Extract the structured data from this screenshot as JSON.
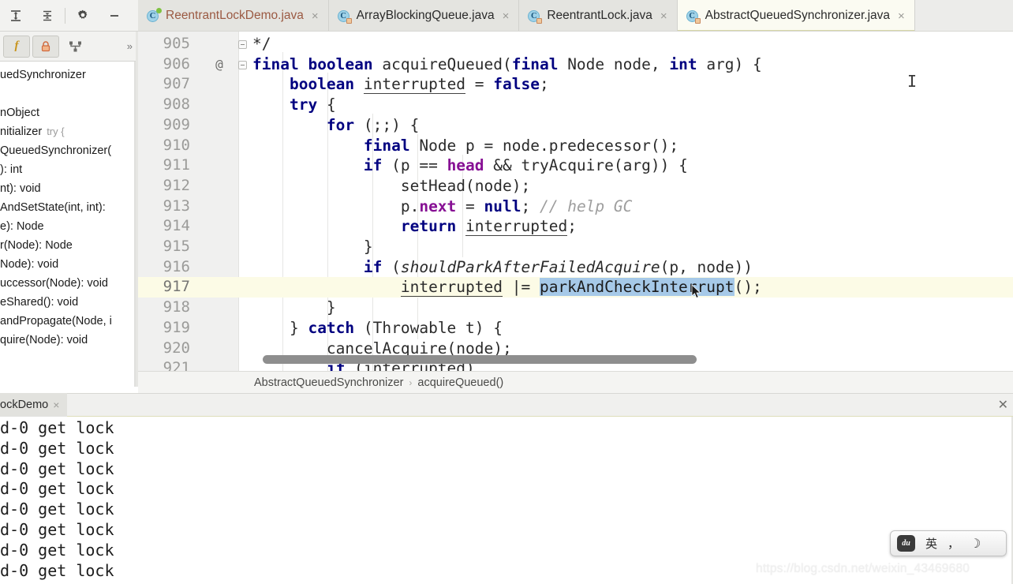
{
  "left_panel": {
    "toolbar": [
      {
        "name": "expand-all",
        "glyph": "expand"
      },
      {
        "name": "collapse-all",
        "glyph": "collapse"
      },
      {
        "name": "settings",
        "glyph": "gear"
      },
      {
        "name": "hide",
        "glyph": "minus"
      }
    ],
    "filters": [
      {
        "name": "show-fields",
        "label": "f",
        "active": true
      },
      {
        "name": "show-non-public",
        "label": "lock",
        "active": true
      },
      {
        "name": "show-inherited",
        "label": "branch",
        "active": false
      }
    ],
    "overflow_label": "»",
    "structure_items": [
      {
        "label": "uedSynchronizer",
        "hint": ""
      },
      {
        "label": "",
        "hint": ""
      },
      {
        "label": "nObject",
        "hint": ""
      },
      {
        "label": "nitializer",
        "hint": "try {"
      },
      {
        "label": "QueuedSynchronizer(",
        "hint": ""
      },
      {
        "label": "): int",
        "hint": ""
      },
      {
        "label": "nt): void",
        "hint": ""
      },
      {
        "label": "AndSetState(int, int):",
        "hint": ""
      },
      {
        "label": "e): Node",
        "hint": ""
      },
      {
        "label": "r(Node): Node",
        "hint": ""
      },
      {
        "label": "Node): void",
        "hint": ""
      },
      {
        "label": "uccessor(Node): void",
        "hint": ""
      },
      {
        "label": "eShared(): void",
        "hint": ""
      },
      {
        "label": "andPropagate(Node, i",
        "hint": ""
      },
      {
        "label": "quire(Node): void",
        "hint": ""
      }
    ]
  },
  "tabs": [
    {
      "name": "ReentrantLockDemo.java",
      "selected": false,
      "modified": true,
      "icon": "java-class-star",
      "close": "×"
    },
    {
      "name": "ArrayBlockingQueue.java",
      "selected": false,
      "modified": false,
      "icon": "java-class-lock",
      "close": "×"
    },
    {
      "name": "ReentrantLock.java",
      "selected": false,
      "modified": false,
      "icon": "java-class-lock",
      "close": "×"
    },
    {
      "name": "AbstractQueuedSynchronizer.java",
      "selected": true,
      "modified": false,
      "icon": "java-class-lock",
      "close": "×"
    }
  ],
  "editor": {
    "first_line": 905,
    "caret_line": 917,
    "selection_text": "parkAndCheckInterrupt",
    "lines": [
      {
        "num": "905",
        "ann": "",
        "fold": true,
        "text": "*/",
        "indent": 1
      },
      {
        "num": "906",
        "ann": "@",
        "fold": true,
        "text": "final boolean acquireQueued(final Node node, int arg) {",
        "indent": 1
      },
      {
        "num": "907",
        "ann": "",
        "fold": false,
        "text": "boolean interrupted = false;",
        "indent": 2
      },
      {
        "num": "908",
        "ann": "",
        "fold": false,
        "text": "try {",
        "indent": 2
      },
      {
        "num": "909",
        "ann": "",
        "fold": false,
        "text": "for (;;) {",
        "indent": 3
      },
      {
        "num": "910",
        "ann": "",
        "fold": false,
        "text": "final Node p = node.predecessor();",
        "indent": 4
      },
      {
        "num": "911",
        "ann": "",
        "fold": false,
        "text": "if (p == head && tryAcquire(arg)) {",
        "indent": 4
      },
      {
        "num": "912",
        "ann": "",
        "fold": false,
        "text": "setHead(node);",
        "indent": 5
      },
      {
        "num": "913",
        "ann": "",
        "fold": false,
        "text": "p.next = null; // help GC",
        "indent": 5
      },
      {
        "num": "914",
        "ann": "",
        "fold": false,
        "text": "return interrupted;",
        "indent": 5
      },
      {
        "num": "915",
        "ann": "",
        "fold": false,
        "text": "}",
        "indent": 4
      },
      {
        "num": "916",
        "ann": "",
        "fold": false,
        "text": "if (shouldParkAfterFailedAcquire(p, node))",
        "indent": 4
      },
      {
        "num": "917",
        "ann": "",
        "fold": false,
        "text": "interrupted |= parkAndCheckInterrupt();",
        "indent": 5
      },
      {
        "num": "918",
        "ann": "",
        "fold": false,
        "text": "}",
        "indent": 3
      },
      {
        "num": "919",
        "ann": "",
        "fold": false,
        "text": "} catch (Throwable t) {",
        "indent": 2
      },
      {
        "num": "920",
        "ann": "",
        "fold": false,
        "text": "cancelAcquire(node);",
        "indent": 3
      },
      {
        "num": "921",
        "ann": "",
        "fold": false,
        "text": "if (interrupted)",
        "indent": 3
      }
    ]
  },
  "breadcrumb": {
    "class": "AbstractQueuedSynchronizer",
    "separator": "›",
    "method": "acquireQueued()"
  },
  "console": {
    "tab_label": "ockDemo",
    "tab_close": "×",
    "panel_close": "✕",
    "lines": [
      "d-0 get lock",
      "d-0 get lock",
      "d-0 get lock",
      "d-0 get lock",
      "d-0 get lock",
      "d-0 get lock",
      "d-0 get lock",
      "d-0 get lock"
    ]
  },
  "ime": {
    "logo": "du",
    "lang": "英",
    "punct": "，",
    "moon": "☽"
  },
  "watermark": "https://blog.csdn.net/weixin_43469680",
  "colors": {
    "keyword": "#000080",
    "field": "#871094",
    "comment": "#9e9e9e",
    "selection": "#a6c9e8",
    "caret_row": "#fcfbe6",
    "tab_selected": "#fbfbf2",
    "modified_tab_text": "#9b5a43"
  }
}
